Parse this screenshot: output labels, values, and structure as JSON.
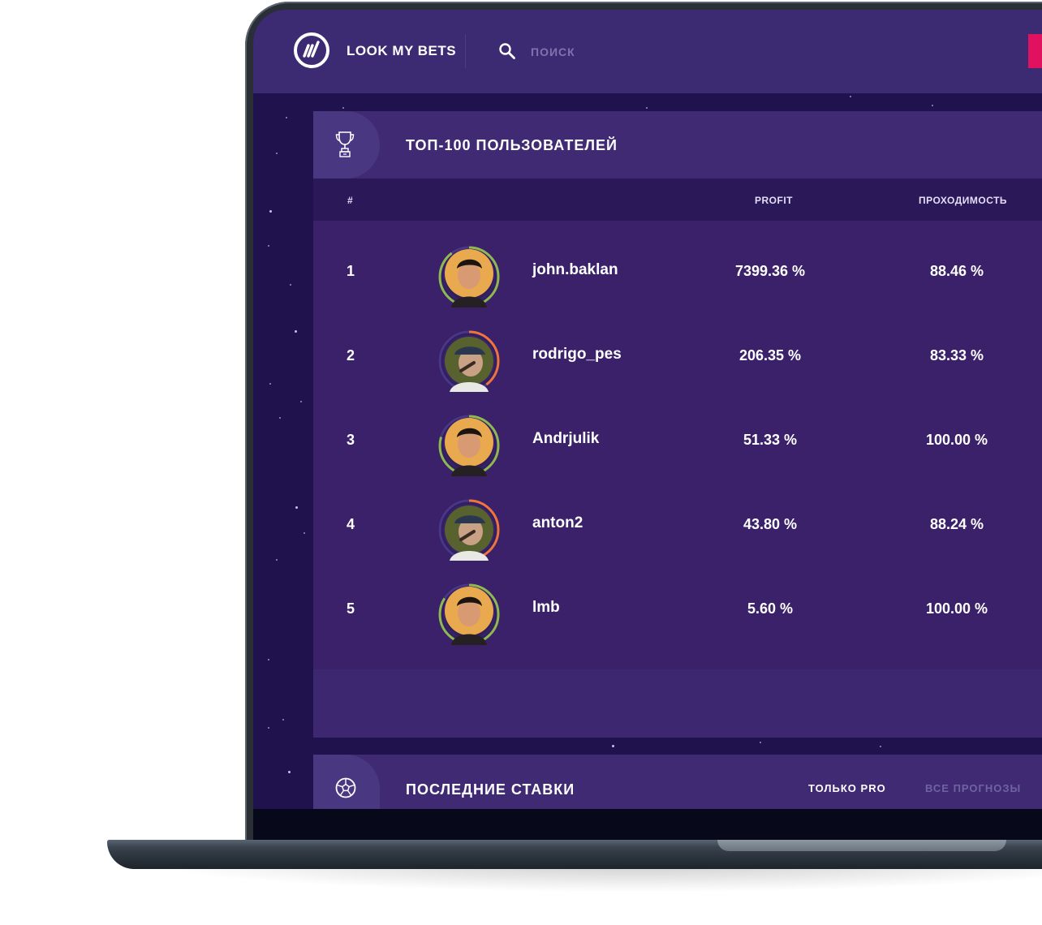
{
  "header": {
    "brand": "LOOK MY BETS",
    "search_placeholder": "ПОИСК"
  },
  "leaderboard": {
    "title": "ТОП-100 ПОЛЬЗОВАТЕЛЕЙ",
    "columns": {
      "rank": "#",
      "profit": "PROFIT",
      "pass_rate": "ПРОХОДИМОСТЬ"
    },
    "rows": [
      {
        "rank": "1",
        "username": "john.baklan",
        "profit": "7399.36 %",
        "pass_rate": "88.46 %"
      },
      {
        "rank": "2",
        "username": "rodrigo_pes",
        "profit": "206.35 %",
        "pass_rate": "83.33 %"
      },
      {
        "rank": "3",
        "username": "Andrjulik",
        "profit": "51.33 %",
        "pass_rate": "100.00 %"
      },
      {
        "rank": "4",
        "username": "anton2",
        "profit": "43.80 %",
        "pass_rate": "88.24 %"
      },
      {
        "rank": "5",
        "username": "lmb",
        "profit": "5.60 %",
        "pass_rate": "100.00 %"
      }
    ]
  },
  "recent_bets": {
    "title": "ПОСЛЕДНИЕ СТАВКИ",
    "tabs": [
      "ТОЛЬКО PRO",
      "ВСЕ ПРОГНОЗЫ"
    ]
  },
  "colors": {
    "background": "#20124d",
    "header": "#3c2a72",
    "card": "#3a2169",
    "accent_pink": "#e0115f",
    "ring_green": "#8fb84f",
    "ring_orange": "#f0733a"
  },
  "icons": {
    "logo": "lmb-logo-icon",
    "search": "search-icon",
    "trophy": "trophy-icon",
    "ball": "soccer-ball-icon"
  }
}
